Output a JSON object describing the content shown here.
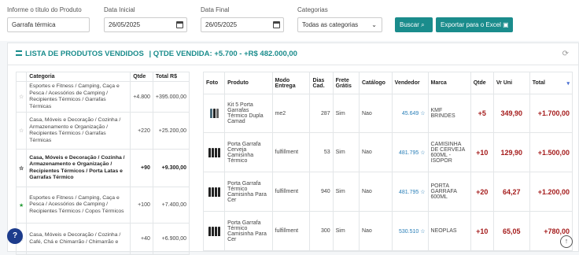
{
  "filters": {
    "product_label": "Informe o título do Produto",
    "product_value": "Garrafa térmica",
    "start_label": "Data Inicial",
    "start_value": "26/05/2025",
    "end_label": "Data Final",
    "end_value": "26/05/2025",
    "category_label": "Categorias",
    "category_value": "Todas as categorias",
    "search_button": "Buscar",
    "export_button": "Exportar para o Excel"
  },
  "card": {
    "title": "LISTA DE PRODUTOS VENDIDOS",
    "summary": "| QTDE VENDIDA: +5.700 - +R$ 482.000,00"
  },
  "left_table": {
    "headers": [
      "Categoria",
      "Qtde",
      "Total R$"
    ],
    "rows": [
      {
        "category": "Esportes e Fitness / Camping, Caça e Pesca / Acessórios de Camping / Recipientes Térmicos / Garrafas Térmicas",
        "qty": "+4.800",
        "total": "+395.000,00"
      },
      {
        "category": "Casa, Móveis e Decoração / Cozinha / Armazenamento e Organização / Recipientes Térmicos / Garrafas Térmicas",
        "qty": "+220",
        "total": "+25.200,00"
      },
      {
        "category": "Casa, Móveis e Decoração / Cozinha / Armazenamento e Organização / Recipientes Térmicos / Porta Latas e Garrafas Térmico",
        "qty": "+90",
        "total": "+9.300,00"
      },
      {
        "category": "Esportes e Fitness / Camping, Caça e Pesca / Acessórios de Camping / Recipientes Térmicos / Copos Térmicos",
        "qty": "+100",
        "total": "+7.400,00"
      },
      {
        "category": "Casa, Móveis e Decoração / Cozinha / Café, Chá e Chimarrão / Chimarrão e",
        "qty": "+40",
        "total": "+6.900,00"
      }
    ]
  },
  "right_table": {
    "headers": [
      "Foto",
      "Produto",
      "Modo Entrega",
      "Dias Cad.",
      "Frete Grátis",
      "Catálogo",
      "Vendedor",
      "Marca",
      "Qtde",
      "Vr Uni",
      "Total"
    ],
    "rows": [
      {
        "product": "Kit 5 Porta Garrafas Térmico Dupla Camad",
        "mode": "me2",
        "days": "287",
        "free": "Sim",
        "catalog": "Nao",
        "seller": "45.649 ☆",
        "brand": "KMF BRINDES",
        "qty": "+5",
        "unit": "349,90",
        "total": "+1.700,00"
      },
      {
        "product": "Porta Garrafa Cerveja Camisinha Térmico",
        "mode": "fulfillment",
        "days": "53",
        "free": "Sim",
        "catalog": "Nao",
        "seller": "481.795 ☆",
        "brand": "CAMISINHA DE CERVEJA 600ML - ISOPOR",
        "qty": "+10",
        "unit": "129,90",
        "total": "+1.500,00"
      },
      {
        "product": "Porta Garrafa Térmico Camisinha Para Cer",
        "mode": "fulfillment",
        "days": "940",
        "free": "Sim",
        "catalog": "Nao",
        "seller": "481.795 ☆",
        "brand": "PORTA GARRAFA 600ML",
        "qty": "+20",
        "unit": "64,27",
        "total": "+1.200,00"
      },
      {
        "product": "Porta Garrafa Térmico Camisinha Para Cer",
        "mode": "fulfillment",
        "days": "300",
        "free": "Sim",
        "catalog": "Nao",
        "seller": "530.510 ☆",
        "brand": "NEOPLAS",
        "qty": "+10",
        "unit": "65,05",
        "total": "+780,00"
      }
    ]
  },
  "icons": {
    "search": "search-icon",
    "excel": "excel-icon",
    "refresh": "refresh-icon",
    "help": "help-icon",
    "scroll_up": "arrow-up-icon",
    "sort": "sort-desc-icon"
  },
  "colors": {
    "accent": "#1a8c8c",
    "value_red": "#a51c1c",
    "help_blue": "#1d3c8c"
  }
}
